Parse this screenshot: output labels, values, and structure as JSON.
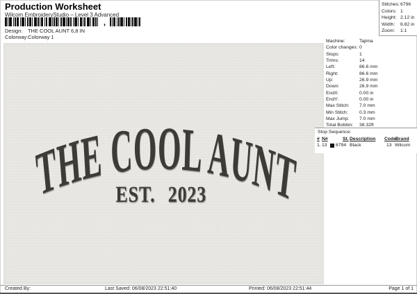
{
  "header": {
    "title": "Production Worksheet",
    "subtitle": "Wilcom EmbroideryStudio – Level 3 Advanced",
    "design_label": "Design:",
    "design_value": "THE COOL AUNT 6,8 IN",
    "colorway_label": "Colorway:",
    "colorway_value": "Colorway 1"
  },
  "barcode": {
    "comma": ",",
    "group_offsets": [
      0,
      151
    ],
    "groups": [
      [
        3,
        1,
        1,
        1,
        4,
        2,
        1,
        1,
        2,
        1,
        3,
        2,
        1,
        1,
        4,
        1,
        1,
        2,
        2,
        1,
        3,
        1,
        1,
        2,
        4,
        1,
        2,
        1,
        1,
        1,
        3,
        2,
        1,
        1,
        2,
        2,
        4,
        1,
        1,
        1,
        2,
        1,
        3,
        1,
        1,
        2,
        2,
        1,
        4,
        1,
        1,
        1,
        3,
        1,
        2,
        2,
        1,
        1,
        4,
        1,
        1,
        2,
        3,
        1,
        1,
        1,
        2,
        2,
        4,
        1,
        1,
        2,
        3,
        1,
        2,
        1,
        1,
        1
      ],
      [
        2,
        1,
        1,
        1,
        3,
        2,
        1,
        1,
        2,
        1,
        4,
        1,
        1,
        2,
        2,
        1,
        3,
        1,
        1,
        1,
        2,
        1,
        4,
        1,
        1,
        1,
        2,
        1
      ]
    ],
    "bar_color": "#111111"
  },
  "stats_box": {
    "rows": [
      {
        "label": "Stitches:",
        "value": "6796"
      },
      {
        "label": "Colors:",
        "value": "1"
      },
      {
        "label": "Height:",
        "value": "2.12 in"
      },
      {
        "label": "Width:",
        "value": "6.82 in"
      },
      {
        "label": "Zoom:",
        "value": "1:1"
      }
    ]
  },
  "machine_panel": {
    "rows": [
      {
        "label": "Machine:",
        "value": "Tajima"
      },
      {
        "label": "Color changes:",
        "value": "0"
      },
      {
        "label": "Stops:",
        "value": "1"
      },
      {
        "label": "Trims:",
        "value": "14"
      },
      {
        "label": "Left:",
        "value": "86.6 mm"
      },
      {
        "label": "Right:",
        "value": "86.6 mm"
      },
      {
        "label": "Up:",
        "value": "26.9 mm"
      },
      {
        "label": "Down:",
        "value": "26.9 mm"
      },
      {
        "label": "EndX:",
        "value": "0.00 in"
      },
      {
        "label": "EndY:",
        "value": "0.00 in"
      },
      {
        "label": "Max Stitch:",
        "value": "7.0 mm"
      },
      {
        "label": "Min Stitch:",
        "value": "0.3 mm"
      },
      {
        "label": "Max Jump:",
        "value": "7.0 mm"
      },
      {
        "label": "Total Bobbin:",
        "value": "38.32ft"
      }
    ]
  },
  "stop_sequence": {
    "title": "Stop Sequence:",
    "columns": [
      "#",
      "N#",
      "St.",
      "Description",
      "Code",
      "Brand"
    ],
    "row": {
      "num": "1.",
      "n": "13",
      "swatch_color": "#141414",
      "st": "6794",
      "description": "Black",
      "code": "13",
      "brand": "Wilcom"
    }
  },
  "design": {
    "arc_text": "THE COOL AUNT",
    "sub_text": "EST. 2023",
    "thread_color": "#3e3b34",
    "fabric_color": "#e9e8e5"
  },
  "footer": {
    "created_by": "Created By:",
    "last_saved": "Last Saved: 06/08/2023 22:51:40",
    "printed": "Printed: 06/08/2023 22:51:44",
    "page": "Page 1 of 1"
  }
}
